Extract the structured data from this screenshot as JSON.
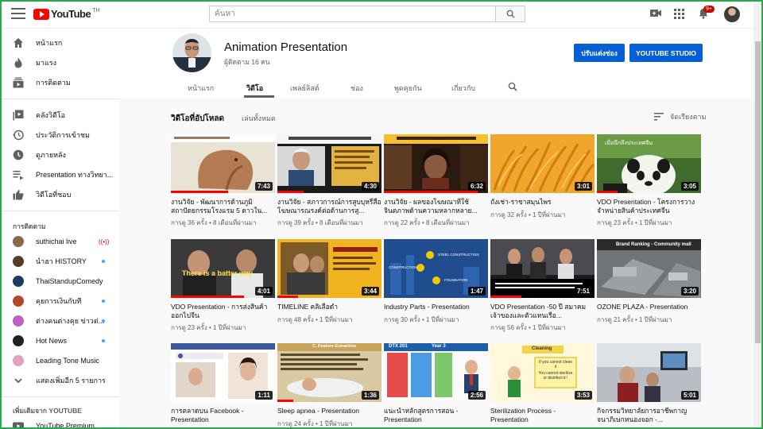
{
  "masthead": {
    "logo_text": "YouTube",
    "logo_region": "TH",
    "search_placeholder": "ค้นหา",
    "notification_count": "9+"
  },
  "sidebar": {
    "main_items": [
      {
        "label": "หน้าแรก",
        "icon": "home-icon"
      },
      {
        "label": "มาแรง",
        "icon": "flame-icon"
      },
      {
        "label": "การติดตาม",
        "icon": "subscriptions-icon"
      }
    ],
    "library_items": [
      {
        "label": "คลังวิดีโอ",
        "icon": "library-icon"
      },
      {
        "label": "ประวัติการเข้าชม",
        "icon": "history-icon"
      },
      {
        "label": "ดูภายหลัง",
        "icon": "clock-icon"
      },
      {
        "label": "Presentation ทางวิทยา...",
        "icon": "playlist-icon"
      },
      {
        "label": "วิดีโอที่ชอบ",
        "icon": "thumbs-up-icon"
      }
    ],
    "subscriptions_heading": "การติดตาม",
    "subscriptions": [
      {
        "label": "suthichai live",
        "indicator": "live",
        "color": "#8a6a4a"
      },
      {
        "label": "นำฮา HISTORY",
        "indicator": "dot",
        "color": "#5a3b2b"
      },
      {
        "label": "ThaiStandupComedy",
        "indicator": "",
        "color": "#1d3b63"
      },
      {
        "label": "คุยการเงินกับที",
        "indicator": "dot",
        "color": "#b04a2a"
      },
      {
        "label": "ต่างคนต่างคุย ข่าวต่...",
        "indicator": "dot",
        "color": "#c060c0"
      },
      {
        "label": "Hot News",
        "indicator": "dot",
        "color": "#222222"
      },
      {
        "label": "Leading Tone Music",
        "indicator": "",
        "color": "#e0a0c0"
      }
    ],
    "show_more": "แสดงเพิ่มอีก 5 รายการ",
    "more_heading": "เพิ่มเติมจาก YOUTUBE",
    "more_items": [
      {
        "label": "YouTube Premium"
      }
    ]
  },
  "channel": {
    "name": "Animation Presentation",
    "subscribers": "ผู้ติดตาม 16 คน",
    "customize_label": "ปรับแต่งช่อง",
    "studio_label": "YOUTUBE STUDIO",
    "tabs": [
      "หน้าแรก",
      "วิดีโอ",
      "เพลย์ลิสต์",
      "ช่อง",
      "พูดคุยกัน",
      "เกี่ยวกับ"
    ],
    "active_tab": "วิดีโอ"
  },
  "content": {
    "section_title": "วิดีโอที่อัปโหลด",
    "play_all": "เล่นทั้งหมด",
    "sort_label": "จัดเรียงตาม"
  },
  "videos": [
    {
      "title": "งานวิจัย - พัฒนาการด้านภูมิสถาปัตยกรรมโรงแรม 5 ดาวใน...",
      "views": "การดู 36 ครั้ง",
      "age": "8 เดือนที่ผ่านมา",
      "duration": "7:43",
      "progress": 0.55
    },
    {
      "title": "งานวิจัย - สภาวการณ์การสูบบุหรี่สื่อโฆษณารณรงค์ต่อต้านการสู...",
      "views": "การดู 39 ครั้ง",
      "age": "8 เดือนที่ผ่านมา",
      "duration": "4:30",
      "progress": 0.25
    },
    {
      "title": "งานวิจัย - ผลของโฆษณาที่ใช้จินตภาพด้านความหลากหลาย...",
      "views": "การดู 22 ครั้ง",
      "age": "8 เดือนที่ผ่านมา",
      "duration": "6:32",
      "progress": 0.9
    },
    {
      "title": "ถั่งเช่า-ราชาสมุนไพร",
      "views": "การดู 32 ครั้ง",
      "age": "1 ปีที่ผ่านมา",
      "duration": "3:01",
      "progress": 0
    },
    {
      "title": "VDO Presentation - โครงการวางจำหน่ายสินค้าประเทศจีน",
      "views": "การดู 23 ครั้ง",
      "age": "1 ปีที่ผ่านมา",
      "duration": "3:05",
      "progress": 0.2
    },
    {
      "title": "VDO Presentation - การส่งสินค้าออกไปจีน",
      "views": "การดู 23 ครั้ง",
      "age": "1 ปีที่ผ่านมา",
      "duration": "4:01",
      "progress": 0.7
    },
    {
      "title": "TIMELINE คลิเลือดำ",
      "views": "การดู 48 ครั้ง",
      "age": "1 ปีที่ผ่านมา",
      "duration": "3:44",
      "progress": 0.2
    },
    {
      "title": "Industry Parts - Presentation",
      "views": "การดู 30 ครั้ง",
      "age": "1 ปีที่ผ่านมา",
      "duration": "1:47",
      "progress": 0
    },
    {
      "title": "VDO Presentation -50 ปี สมาคมเจ้าของและตัวแทนเรือ...",
      "views": "การดู 56 ครั้ง",
      "age": "1 ปีที่ผ่านมา",
      "duration": "7:51",
      "progress": 0.3
    },
    {
      "title": "OZONE PLAZA - Presentation",
      "views": "การดู 21 ครั้ง",
      "age": "1 ปีที่ผ่านมา",
      "duration": "3:20",
      "progress": 0
    },
    {
      "title": "การตลาดบน Facebook - Presentation",
      "views": "การดู",
      "age": "",
      "duration": "1:11",
      "progress": 0
    },
    {
      "title": "Sleep apnea - Presentation",
      "views": "การดู 24 ครั้ง",
      "age": "1 ปีที่ผ่านมา",
      "duration": "1:36",
      "progress": 0.15
    },
    {
      "title": "แนะนำหลักสูตรการสอน - Presentation",
      "views": "",
      "age": "",
      "duration": "2:56",
      "progress": 0
    },
    {
      "title": "Sterilization Process - Presentation",
      "views": "",
      "age": "",
      "duration": "3:53",
      "progress": 0
    },
    {
      "title": "กิจกรรมวิทยาลัยการอาชีพกาญจนาภิเษกหนองจอก -...",
      "views": "",
      "age": "",
      "duration": "5:01",
      "progress": 0
    }
  ],
  "thumb_text": {
    "t2": "ภาพรวมสื่อวิดีโอ",
    "t5": "เมื่อนึกถึงประเทศจีน",
    "t6": "There is a batter way",
    "t8a": "STEEL CONSTRUCTION",
    "t8b": "CONSTRUCTION",
    "t8c": "FOUNDATION",
    "t10": "Brand Ranking - Community mall",
    "t12": "C. Feature Extraction",
    "t13a": "DTX 201",
    "t13b": "Year 3",
    "t14a": "Cleaning",
    "t14b": "If you cannot clean it",
    "t14c": "You cannot sterilize or disinfect it !"
  }
}
